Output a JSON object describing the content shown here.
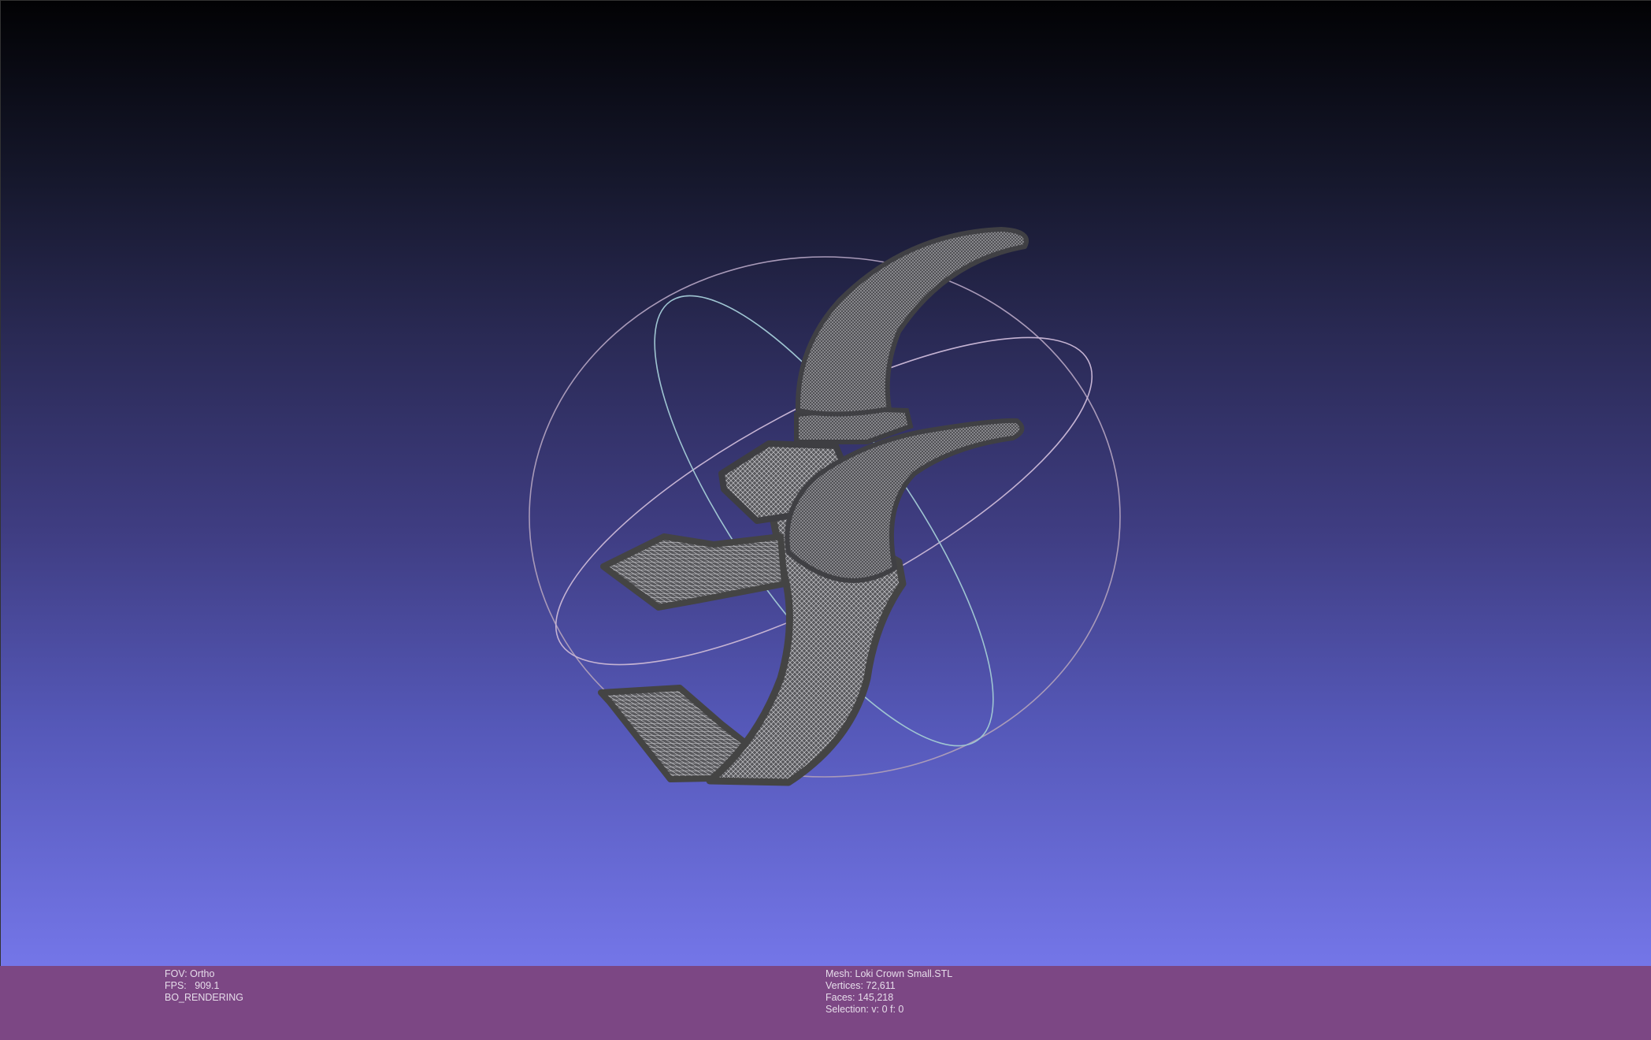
{
  "viewer": {
    "background_top": "#020204",
    "background_bottom": "#7476e8",
    "info_bar_color": "#7c4784",
    "mesh_color": "#4a4a4d",
    "trackball_color": "#b7a9c8"
  },
  "status_left": {
    "fov": "FOV: Ortho",
    "fps": "FPS:   909.1",
    "render_mode": "BO_RENDERING"
  },
  "status_right": {
    "mesh": "Mesh: Loki Crown Small.STL",
    "vertices": "Vertices: 72,611",
    "faces": "Faces: 145,218",
    "selection": "Selection: v: 0 f: 0"
  }
}
